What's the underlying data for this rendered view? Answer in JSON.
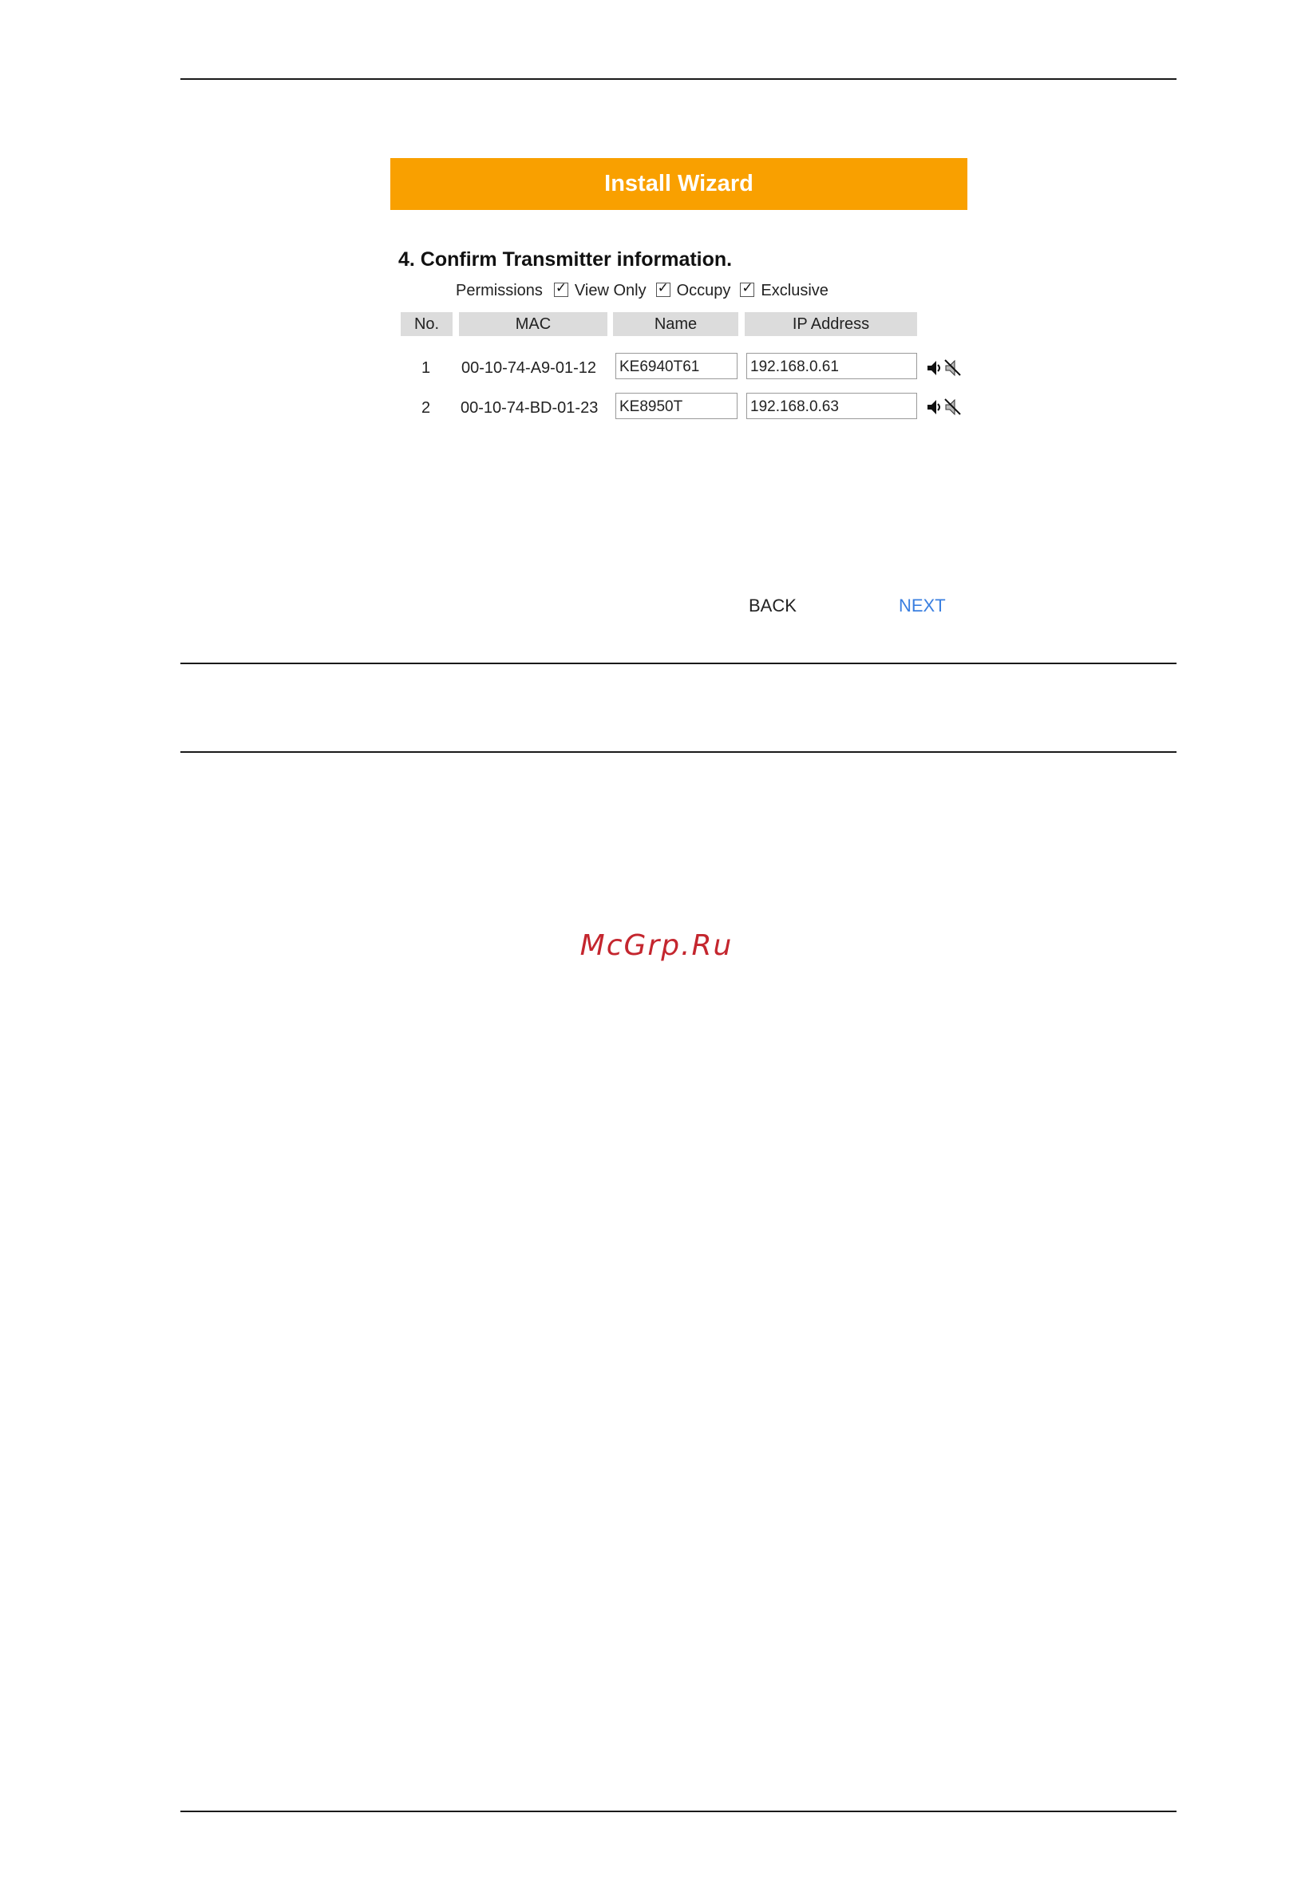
{
  "wizard": {
    "title": "Install Wizard",
    "step_title": "4. Confirm Transmitter information.",
    "permissions": {
      "label": "Permissions",
      "options": [
        {
          "label": "View Only",
          "checked": true
        },
        {
          "label": "Occupy",
          "checked": true
        },
        {
          "label": "Exclusive",
          "checked": true
        }
      ]
    },
    "table": {
      "headers": [
        "No.",
        "MAC",
        "Name",
        "IP Address"
      ],
      "rows": [
        {
          "no": "1",
          "mac": "00-10-74-A9-01-12",
          "name": "KE6940T61",
          "ip": "192.168.0.61",
          "icons": [
            "speaker-icon",
            "mute-icon"
          ]
        },
        {
          "no": "2",
          "mac": "00-10-74-BD-01-23",
          "name": "KE8950T",
          "ip": "192.168.0.63",
          "icons": [
            "speaker-icon",
            "mute-icon"
          ]
        }
      ]
    },
    "buttons": {
      "back": "BACK",
      "next": "NEXT"
    },
    "colors": {
      "header_bg": "#f9a000",
      "next_link": "#3a7fe0"
    }
  },
  "watermark": "McGrp.Ru"
}
